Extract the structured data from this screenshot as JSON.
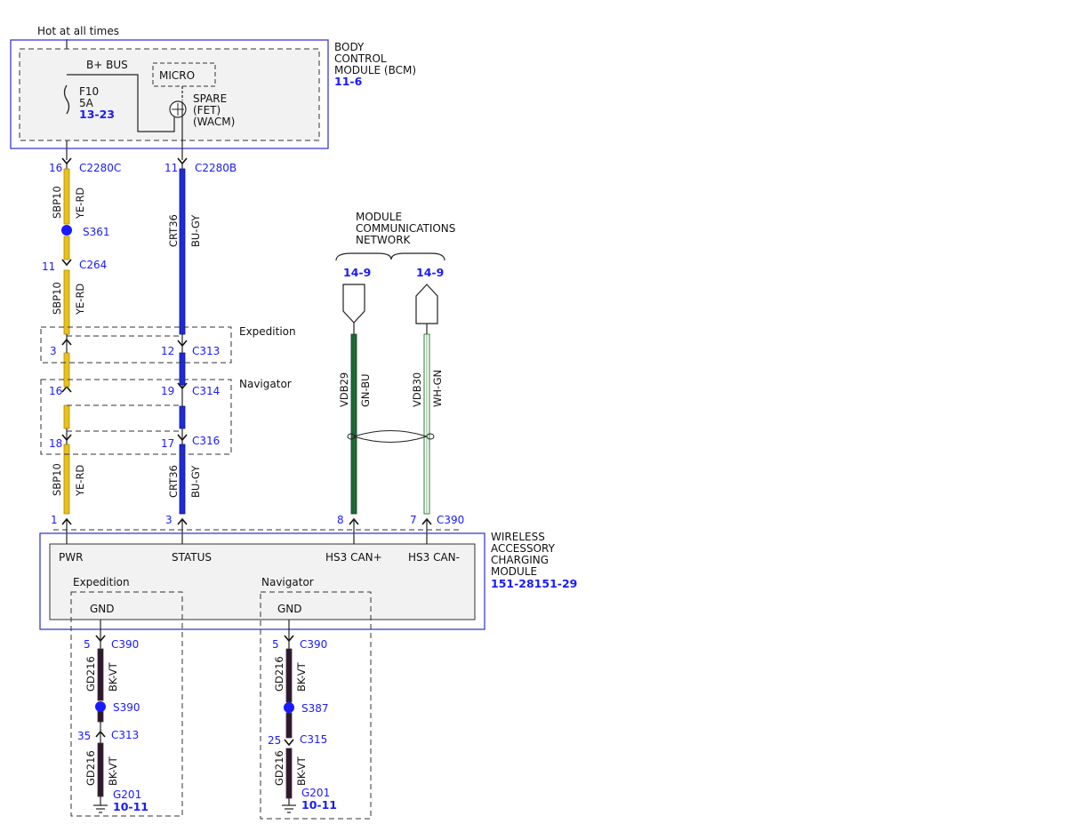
{
  "colors": {
    "accent_blue": "#1a1aff",
    "wire_ye_rd": "#e8c21a",
    "wire_bu_gy": "#1f2bd6",
    "wire_gn_bu": "#1e6b34",
    "wire_wh_gn": "#ffffff",
    "wire_bk_vt": "#2a1a2a",
    "module_fill": "#f2f2f2"
  },
  "power": {
    "label": "Hot at all times"
  },
  "bcm": {
    "name_lines": [
      "BODY",
      "CONTROL",
      "MODULE (BCM)"
    ],
    "ref": "11-6",
    "bplus": "B+ BUS",
    "micro": "MICRO",
    "fuse_id": "F10",
    "fuse_amp": "5A",
    "fuse_ref": "13-23",
    "output_lines": [
      "SPARE",
      "(FET)",
      "(WACM)"
    ]
  },
  "left_wire": {
    "top_pin": "16",
    "top_conn": "C2280C",
    "circuit": "SBP10",
    "color": "YE-RD",
    "splice": "S361",
    "c264_pin": "11",
    "c264": "C264",
    "exp_pin": "3",
    "nav_pin1": "16",
    "nav_pin2": "18",
    "bottom_pin": "1"
  },
  "mid_wire": {
    "top_pin": "11",
    "top_conn": "C2280B",
    "circuit": "CRT36",
    "color": "BU-GY",
    "exp_pin": "12",
    "exp_conn": "C313",
    "nav_pin1": "19",
    "nav_conn1": "C314",
    "nav_pin2": "17",
    "nav_conn2": "C316",
    "bottom_pin": "3"
  },
  "expedition_label": "Expedition",
  "navigator_label": "Navigator",
  "network": {
    "lines": [
      "MODULE",
      "COMMUNICATIONS",
      "NETWORK"
    ],
    "ref_left": "14-9",
    "ref_right": "14-9",
    "wire1_circuit": "VDB29",
    "wire1_color": "GN-BU",
    "wire2_circuit": "VDB30",
    "wire2_color": "WH-GN",
    "pin1": "8",
    "pin2": "7",
    "conn": "C390"
  },
  "wacm": {
    "name_lines": [
      "WIRELESS",
      "ACCESSORY",
      "CHARGING",
      "MODULE"
    ],
    "ref": "151-28151-29",
    "pwr": "PWR",
    "status": "STATUS",
    "can_hi": "HS3 CAN+",
    "can_lo": "HS3 CAN-",
    "gnd": "GND"
  },
  "gnd_left": {
    "variant": "Expedition",
    "pin1": "5",
    "conn1": "C390",
    "circuit": "GD216",
    "color": "BK-VT",
    "splice": "S390",
    "pin2": "35",
    "conn2": "C313",
    "ground": "G201",
    "ground_ref": "10-11"
  },
  "gnd_right": {
    "variant": "Navigator",
    "pin1": "5",
    "conn1": "C390",
    "circuit": "GD216",
    "color": "BK-VT",
    "splice": "S387",
    "pin2": "25",
    "conn2": "C315",
    "ground": "G201",
    "ground_ref": "10-11"
  }
}
